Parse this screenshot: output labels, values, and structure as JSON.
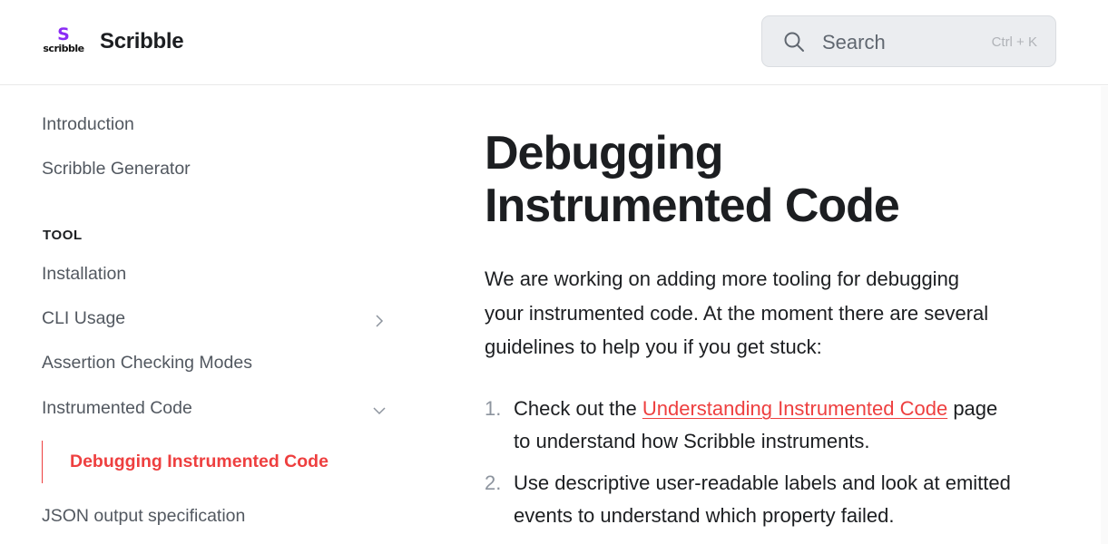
{
  "header": {
    "logo": {
      "mark": "S",
      "wordmark": "scribble"
    },
    "brand": "Scribble",
    "search": {
      "placeholder": "Search",
      "shortcut": "Ctrl + K",
      "icon": "search-icon"
    }
  },
  "sidebar": {
    "items_top": [
      {
        "label": "Introduction"
      },
      {
        "label": "Scribble Generator"
      }
    ],
    "section_title": "TOOL",
    "items": [
      {
        "label": "Installation"
      },
      {
        "label": "CLI Usage",
        "icon": "chevron-right-icon"
      },
      {
        "label": "Assertion Checking Modes"
      },
      {
        "label": "Instrumented Code",
        "icon": "chevron-down-icon"
      }
    ],
    "active_item": "Debugging Instrumented Code",
    "items_after": [
      {
        "label": "JSON output specification"
      }
    ]
  },
  "main": {
    "title_line1": "Debugging",
    "title_line2": "Instrumented Code",
    "intro": "We are working on adding more tooling for debugging your instrumented code. At the moment there are several guidelines to help you if you get stuck:",
    "list": [
      {
        "num": "1.",
        "before": "Check out the ",
        "link": "Understanding Instrumented Code",
        "after": " page to understand how Scribble instruments."
      },
      {
        "num": "2.",
        "text": "Use descriptive user-readable labels and look at emitted events to understand which property failed."
      }
    ]
  },
  "colors": {
    "accent": "#ee3f3f",
    "logo": "#8b2cf5"
  }
}
